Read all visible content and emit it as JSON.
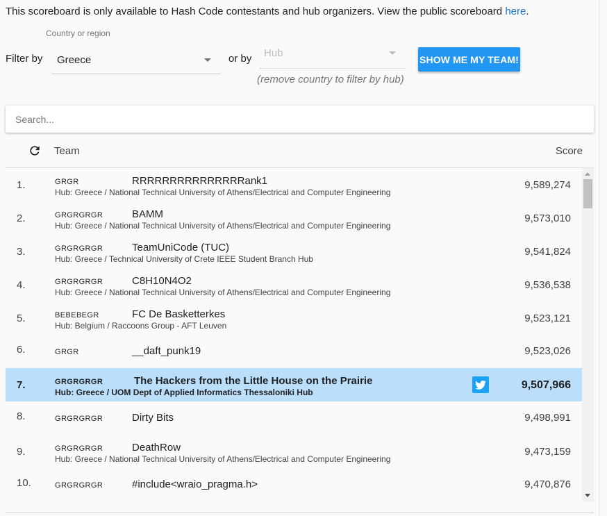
{
  "notice": {
    "text": "This scoreboard is only available to Hash Code contestants and hub organizers. View the public scoreboard ",
    "link_label": "here",
    "tail": "."
  },
  "filters": {
    "filter_label": "Filter by",
    "country_label": "Country or region",
    "country_value": "Greece",
    "or_label": "or by",
    "hub_placeholder": "Hub",
    "hub_hint": "(remove country to filter by hub)",
    "team_button": "SHOW ME MY TEAM!"
  },
  "search": {
    "placeholder": "Search..."
  },
  "table": {
    "headers": {
      "team": "Team",
      "score": "Score"
    },
    "rows": [
      {
        "rank": "1.",
        "country": "GRGR",
        "name": "RRRRRRRRRRRRRRRank1",
        "hub": "Hub: Greece / National Technical University of Athens/Electrical and Computer Engineering",
        "score": "9,589,274"
      },
      {
        "rank": "2.",
        "country": "GRGRGRGR",
        "name": "BAMM",
        "hub": "Hub: Greece / National Technical University of Athens/Electrical and Computer Engineering",
        "score": "9,573,010"
      },
      {
        "rank": "3.",
        "country": "GRGRGRGR",
        "name": "TeamUniCode (TUC)",
        "hub": "Hub: Greece / Technical University of Crete IEEE Student Branch Hub",
        "score": "9,541,824"
      },
      {
        "rank": "4.",
        "country": "GRGRGRGR",
        "name": "C8H10N4O2",
        "hub": "Hub: Greece / National Technical University of Athens/Electrical and Computer Engineering",
        "score": "9,536,538"
      },
      {
        "rank": "5.",
        "country": "BEBEBEGR",
        "name": "FC De Basketterkes",
        "hub": "Hub: Belgium / Raccoons Group - AFT Leuven",
        "score": "9,523,121"
      },
      {
        "rank": "6.",
        "country": "GRGR",
        "name": "__daft_punk19",
        "hub": "",
        "score": "9,523,026"
      },
      {
        "rank": "7.",
        "country": "GRGRGRGR",
        "name": "The Hackers from the Little House on the Prairie",
        "hub": "Hub: Greece / UOM Dept of Applied Informatics Thessaloniki Hub",
        "score": "9,507,966",
        "highlight": true
      },
      {
        "rank": "8.",
        "country": "GRGRGRGR",
        "name": "Dirty Bits",
        "hub": "",
        "score": "9,498,991"
      },
      {
        "rank": "9.",
        "country": "GRGRGRGR",
        "name": "DeathRow",
        "hub": "Hub: Greece / National Technical University of Athens/Electrical and Computer Engineering",
        "score": "9,473,159"
      },
      {
        "rank": "10.",
        "country": "GRGRGRGR",
        "name": "#include<wraio_pragma.h>",
        "hub": "",
        "score": "9,470,876"
      }
    ]
  },
  "icons": {
    "refresh": "refresh-icon",
    "twitter": "twitter-icon"
  },
  "colors": {
    "accent": "#2196f3",
    "highlight": "#bbdefb",
    "link": "#1976d2",
    "twitter": "#1da1f2"
  }
}
